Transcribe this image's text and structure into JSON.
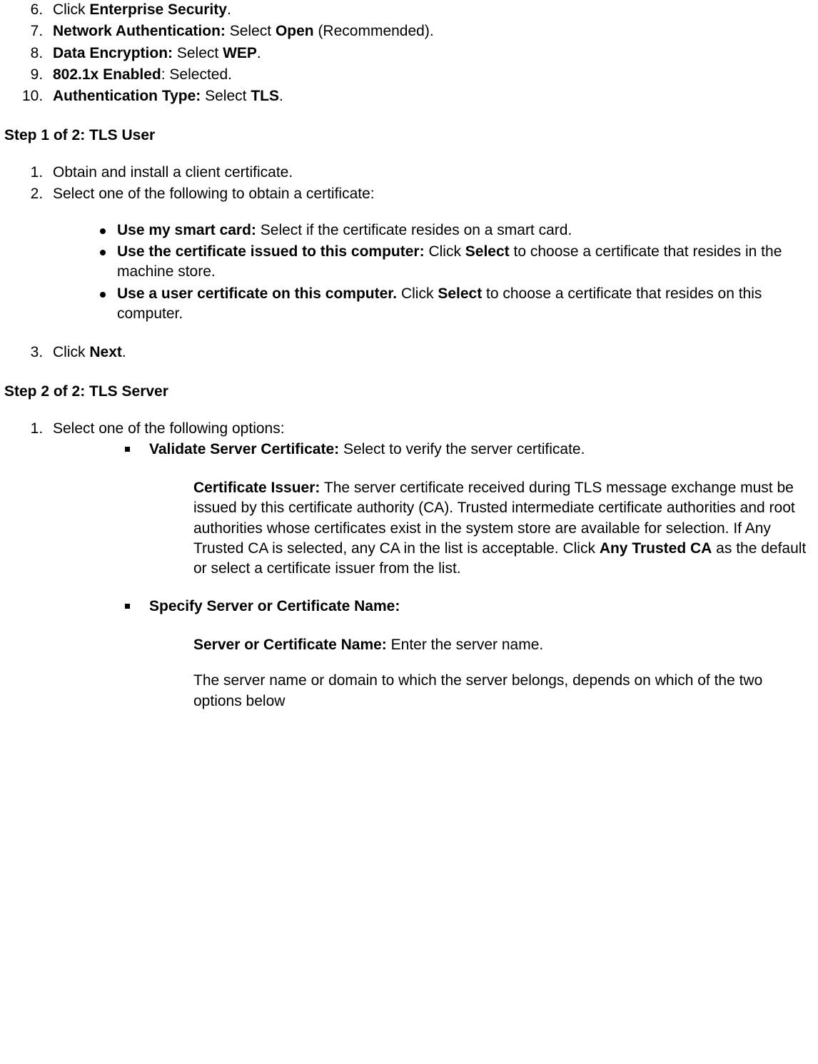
{
  "list1": {
    "i6": {
      "text1": "Click ",
      "b1": "Enterprise Security",
      "text2": "."
    },
    "i7": {
      "b1": "Network Authentication:",
      "text1": " Select ",
      "b2": "Open",
      "text2": " (Recommended)."
    },
    "i8": {
      "b1": "Data Encryption:",
      "text1": " Select ",
      "b2": "WEP",
      "text2": "."
    },
    "i9": {
      "b1": "802.1x Enabled",
      "text1": ": Selected."
    },
    "i10": {
      "b1": "Authentication Type:",
      "text1": " Select ",
      "b2": "TLS",
      "text2": "."
    }
  },
  "step1_heading": "Step 1 of 2: TLS User",
  "list2": {
    "i1": "Obtain and install a client certificate.",
    "i2": "Select one of the following to obtain a certificate:",
    "bullets": {
      "b1": {
        "bold": "Use my smart card:",
        "text": " Select if the certificate resides on a smart card."
      },
      "b2": {
        "bold1": "Use the certificate issued to this computer:",
        "text1": " Click ",
        "bold2": "Select",
        "text2": " to choose a certificate that resides in the machine store."
      },
      "b3": {
        "bold1": "Use a user certificate on this computer.",
        "text1": " Click ",
        "bold2": "Select",
        "text2": " to choose a certificate that resides on this computer."
      }
    },
    "i3": {
      "text1": "Click ",
      "b1": "Next",
      "text2": "."
    }
  },
  "step2_heading": "Step 2 of 2: TLS Server",
  "list3": {
    "i1": "Select one of the following options:",
    "sq1": {
      "bold": "Validate Server Certificate:",
      "text": " Select to verify the server certificate.",
      "para_bold": "Certificate Issuer:",
      "para_text1": " The server certificate received during TLS message exchange must be issued by this certificate authority (CA). Trusted intermediate certificate authorities and root authorities whose certificates exist in the system store are available for selection. If Any Trusted CA is selected, any CA in the list is acceptable. Click ",
      "para_bold2": "Any Trusted CA",
      "para_text2": " as the default or select a certificate issuer from the list."
    },
    "sq2": {
      "bold": "Specify Server or Certificate Name:",
      "p1_bold": "Server or Certificate Name:",
      "p1_text": " Enter the server name.",
      "p2_text": "The server name or domain to which the server belongs, depends on which of the two options below"
    }
  }
}
